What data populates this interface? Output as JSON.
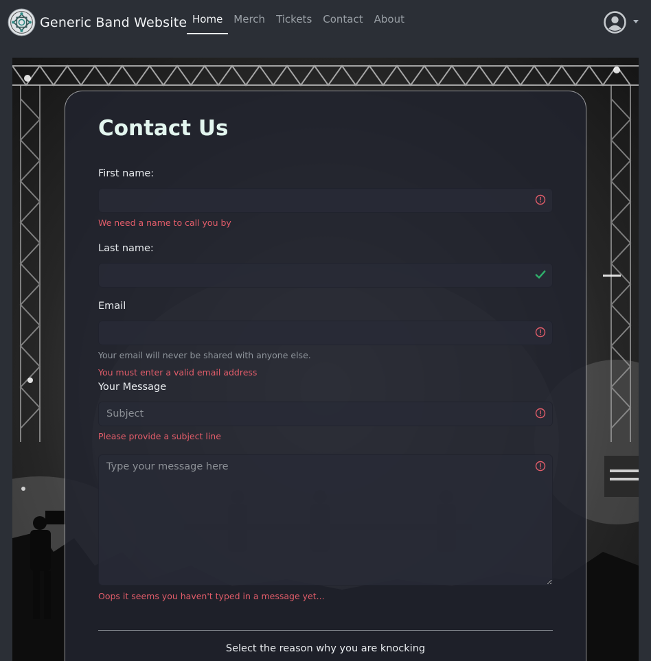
{
  "navbar": {
    "brand": "Generic Band Website",
    "links": [
      {
        "label": "Home",
        "active": true
      },
      {
        "label": "Merch",
        "active": false
      },
      {
        "label": "Tickets",
        "active": false
      },
      {
        "label": "Contact",
        "active": false
      },
      {
        "label": "About",
        "active": false
      }
    ],
    "user_icon": "user-circle-icon"
  },
  "form": {
    "title": "Contact Us",
    "first_name": {
      "label": "First name:",
      "value": "",
      "status": "invalid",
      "error": "We need a name to call you by"
    },
    "last_name": {
      "label": "Last name:",
      "value": "",
      "status": "valid"
    },
    "email": {
      "label": "Email",
      "value": "",
      "status": "invalid",
      "help": "Your email will never be shared with anyone else.",
      "error": "You must enter a valid email address"
    },
    "message_section": {
      "label": "Your Message"
    },
    "subject": {
      "placeholder": "Subject",
      "status": "invalid",
      "error": "Please provide a subject line"
    },
    "message": {
      "placeholder": "Type your message here",
      "status": "invalid",
      "error": "Oops it seems you haven't typed in a message yet..."
    },
    "reason_label": "Select the reason why you are knocking"
  },
  "colors": {
    "invalid": "#e35d6a",
    "valid": "#2fae6b",
    "title": "#e3f6ef"
  }
}
